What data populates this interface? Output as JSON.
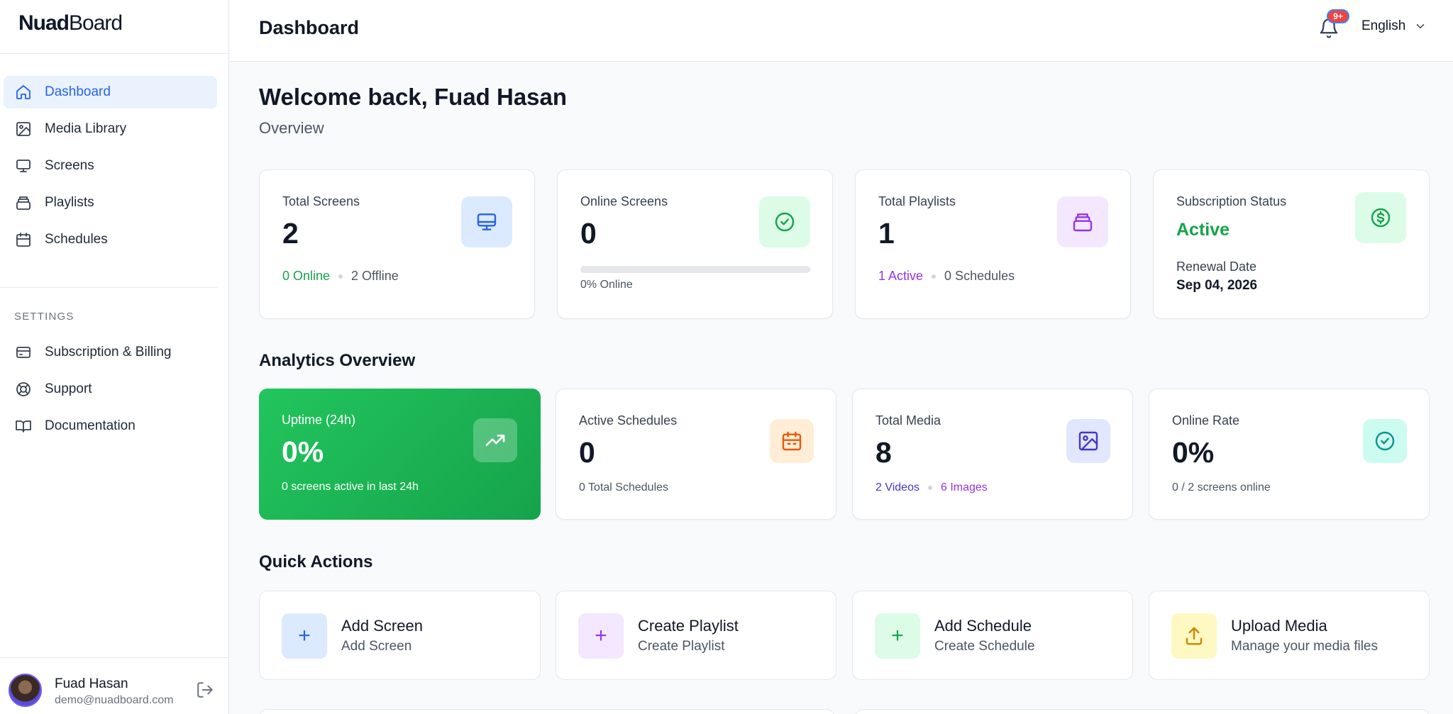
{
  "sidebar": {
    "logo": {
      "bold": "Nuad",
      "light": "Board"
    },
    "nav": [
      {
        "label": "Dashboard",
        "icon": "home-icon",
        "active": true
      },
      {
        "label": "Media Library",
        "icon": "image-icon"
      },
      {
        "label": "Screens",
        "icon": "monitor-icon"
      },
      {
        "label": "Playlists",
        "icon": "stack-icon"
      },
      {
        "label": "Schedules",
        "icon": "calendar-icon"
      }
    ],
    "settings_label": "SETTINGS",
    "settings_nav": [
      {
        "label": "Subscription & Billing",
        "icon": "card-icon"
      },
      {
        "label": "Support",
        "icon": "lifebuoy-icon"
      },
      {
        "label": "Documentation",
        "icon": "book-icon"
      }
    ],
    "user": {
      "name": "Fuad Hasan",
      "email": "demo@nuadboard.com"
    }
  },
  "header": {
    "title": "Dashboard",
    "notification_badge": "9+",
    "language": "English"
  },
  "main": {
    "welcome": "Welcome back, Fuad Hasan",
    "overview": "Overview",
    "stats": {
      "total_screens": {
        "label": "Total Screens",
        "value": "2",
        "online": "0 Online",
        "offline": "2 Offline"
      },
      "online_screens": {
        "label": "Online Screens",
        "value": "0",
        "progress_percent": 0,
        "progress_text": "0% Online"
      },
      "total_playlists": {
        "label": "Total Playlists",
        "value": "1",
        "active": "1 Active",
        "schedules": "0 Schedules"
      },
      "subscription": {
        "label": "Subscription Status",
        "status": "Active",
        "renewal_label": "Renewal Date",
        "renewal_date": "Sep 04, 2026"
      }
    },
    "analytics_title": "Analytics Overview",
    "analytics": {
      "uptime": {
        "label": "Uptime (24h)",
        "value": "0%",
        "sub": "0 screens active in last 24h"
      },
      "active_schedules": {
        "label": "Active Schedules",
        "value": "0",
        "sub": "0 Total Schedules"
      },
      "total_media": {
        "label": "Total Media",
        "value": "8",
        "videos": "2 Videos",
        "images": "6 Images"
      },
      "online_rate": {
        "label": "Online Rate",
        "value": "0%",
        "sub": "0 / 2 screens online"
      }
    },
    "quick_actions_title": "Quick Actions",
    "quick_actions": [
      {
        "title": "Add Screen",
        "desc": "Add Screen",
        "glyph": "+"
      },
      {
        "title": "Create Playlist",
        "desc": "Create Playlist",
        "glyph": "+"
      },
      {
        "title": "Add Schedule",
        "desc": "Create Schedule",
        "glyph": "+"
      },
      {
        "title": "Upload Media",
        "desc": "Manage your media files",
        "glyph": "upload-icon"
      }
    ]
  },
  "colors": {
    "primary": "#2563eb",
    "green": "#16a34a",
    "purple": "#9333ea",
    "indigo": "#4338ca",
    "orange": "#ea580c",
    "teal": "#0d9488"
  }
}
